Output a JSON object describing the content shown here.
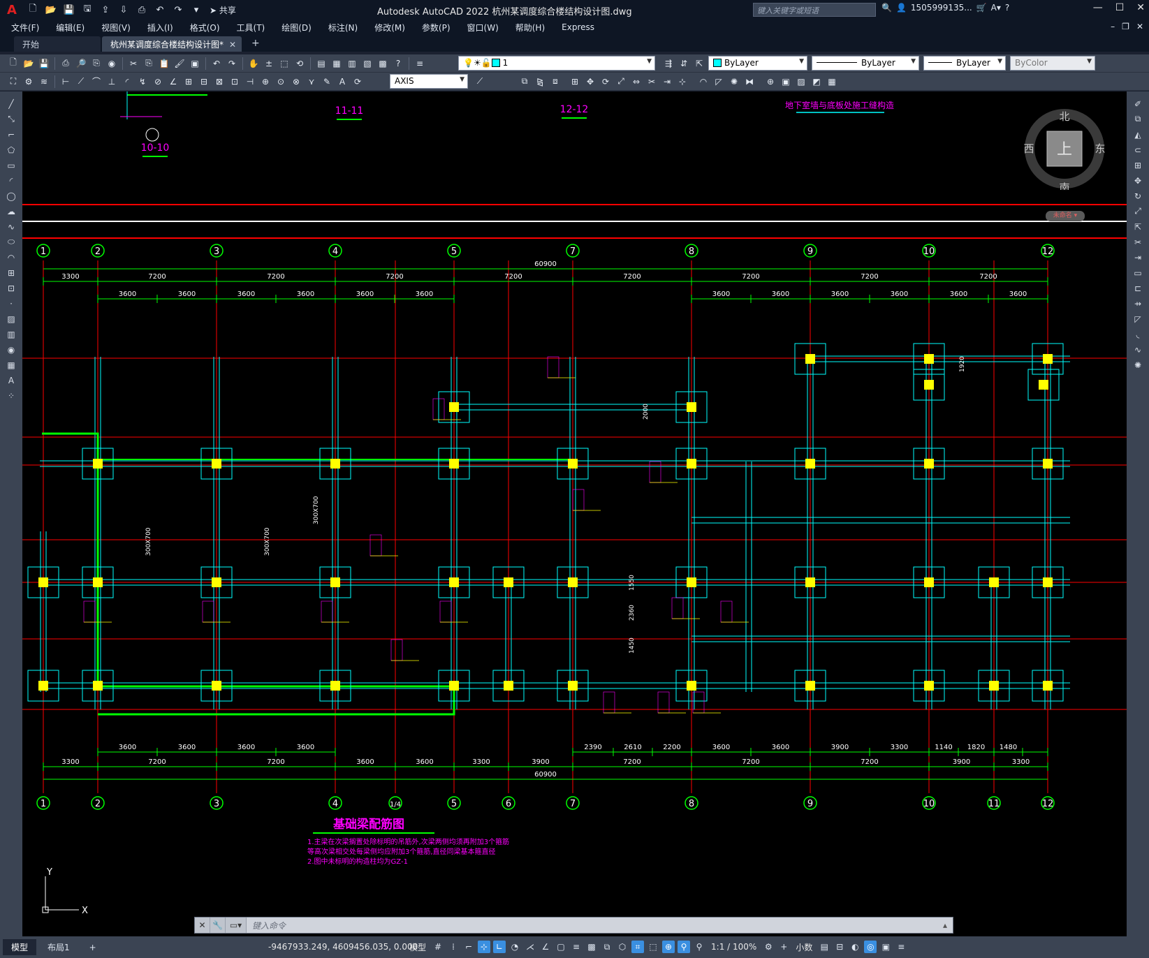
{
  "titlebar": {
    "app_logo": "A",
    "share_label": "共享",
    "title": "Autodesk AutoCAD 2022    杭州某调度综合楼结构设计图.dwg",
    "search_placeholder": "键入关键字或短语",
    "user": "1505999135...",
    "help": "?"
  },
  "menu": [
    "文件(F)",
    "编辑(E)",
    "视图(V)",
    "插入(I)",
    "格式(O)",
    "工具(T)",
    "绘图(D)",
    "标注(N)",
    "修改(M)",
    "参数(P)",
    "窗口(W)",
    "帮助(H)",
    "Express"
  ],
  "tabs": {
    "start": "开始",
    "doc": "杭州某调度综合楼结构设计图*",
    "add": "+"
  },
  "toolbar1": {
    "layer_value": "1",
    "color_value": "ByLayer",
    "linetype_value": "ByLayer",
    "lineweight_value": "ByLayer",
    "plotstyle_value": "ByColor"
  },
  "toolbar2": {
    "dimstyle_value": "AXIS"
  },
  "viewcube": {
    "north": "北",
    "south": "南",
    "east": "东",
    "west": "西",
    "top": "上",
    "wcs": "未命名"
  },
  "drawing": {
    "sections": [
      "10-10",
      "11-11",
      "12-12"
    ],
    "note_title": "地下室墙与底板处施工缝构造",
    "axes_top": [
      "1",
      "2",
      "3",
      "4",
      "5",
      "7",
      "8",
      "9",
      "10",
      "12"
    ],
    "axes_bottom": [
      "1",
      "2",
      "3",
      "4",
      "1/4",
      "5",
      "6",
      "7",
      "8",
      "9",
      "10",
      "11",
      "12"
    ],
    "dim_total": "60900",
    "dims_top_row1": [
      "3300",
      "7200",
      "7200",
      "7200",
      "7200",
      "7200",
      "7200",
      "7200",
      "7200"
    ],
    "dims_top_row2_left": [
      "3600",
      "3600",
      "3600",
      "3600",
      "3600",
      "3600"
    ],
    "dims_top_row2_right": [
      "3600",
      "3600",
      "3600",
      "3600",
      "3600",
      "3600"
    ],
    "dims_bottom_row1": [
      "3600",
      "3600",
      "3600",
      "3600",
      "2390",
      "2610",
      "2200",
      "3600",
      "3600",
      "3900",
      "3300",
      "1140",
      "1820",
      "1480"
    ],
    "dims_bottom_row2": [
      "3300",
      "7200",
      "7200",
      "3600",
      "3600",
      "3300",
      "3900",
      "7200",
      "7200",
      "7200",
      "3900",
      "3300"
    ],
    "small_dims": [
      "2000",
      "1920",
      "1550",
      "2360",
      "1450",
      "300X700",
      "300X700",
      "300X700"
    ],
    "plan_title": "基础梁配筋图",
    "notes": [
      "1.主梁在次梁搁置处除标明的吊筋外,次梁两侧均须再附加3个箍筋",
      "  等高次梁相交处每梁侧均应附加3个箍筋,直径同梁基本箍直径",
      "2.图中未标明的构造柱均为GZ-1"
    ]
  },
  "ucs": {
    "x": "X",
    "y": "Y"
  },
  "cmdline": {
    "placeholder": "键入命令"
  },
  "status": {
    "model_tab": "模型",
    "layout_tab": "布局1",
    "add": "+",
    "coords": "-9467933.249, 4609456.035, 0.000",
    "model": "模型",
    "scale": "1:1 / 100%",
    "units": "小数"
  },
  "colors": {
    "canvas": "#000000",
    "axis_green": "#00ff00",
    "grid_red": "#ff0000",
    "beam_cyan": "#00ffff",
    "column_yellow": "#ffff00",
    "text_magenta": "#ff00ff"
  }
}
